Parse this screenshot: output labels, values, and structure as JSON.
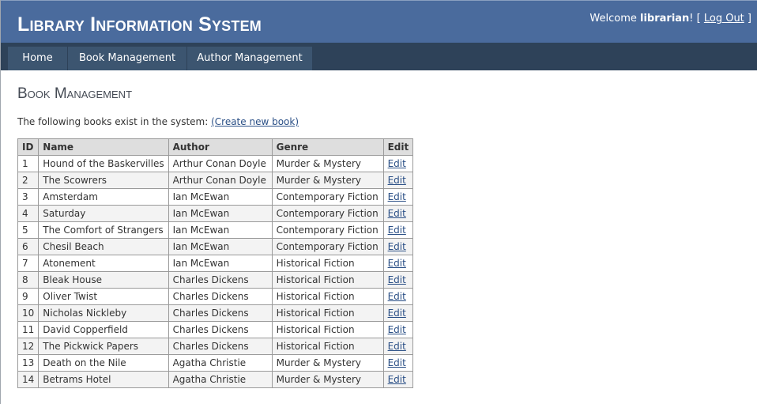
{
  "header": {
    "title": "Library Information System",
    "welcome_prefix": "Welcome ",
    "username": "librarian",
    "welcome_suffix": "! [ ",
    "logout_label": "Log Out",
    "bracket_close": " ]"
  },
  "nav": {
    "items": [
      {
        "label": "Home"
      },
      {
        "label": "Book Management"
      },
      {
        "label": "Author Management"
      }
    ]
  },
  "main": {
    "title": "Book Management",
    "intro_text": "The following books exist in the system: ",
    "create_link": "(Create new book)"
  },
  "table": {
    "columns": [
      "ID",
      "Name",
      "Author",
      "Genre",
      "Edit"
    ],
    "rows": [
      {
        "id": "1",
        "name": "Hound of the Baskervilles",
        "author": "Arthur Conan Doyle",
        "genre": "Murder & Mystery",
        "edit": "Edit"
      },
      {
        "id": "2",
        "name": "The Scowrers",
        "author": "Arthur Conan Doyle",
        "genre": "Murder & Mystery",
        "edit": "Edit"
      },
      {
        "id": "3",
        "name": "Amsterdam",
        "author": "Ian McEwan",
        "genre": "Contemporary Fiction",
        "edit": "Edit"
      },
      {
        "id": "4",
        "name": "Saturday",
        "author": "Ian McEwan",
        "genre": "Contemporary Fiction",
        "edit": "Edit"
      },
      {
        "id": "5",
        "name": "The Comfort of Strangers",
        "author": "Ian McEwan",
        "genre": "Contemporary Fiction",
        "edit": "Edit"
      },
      {
        "id": "6",
        "name": "Chesil Beach",
        "author": "Ian McEwan",
        "genre": "Contemporary Fiction",
        "edit": "Edit"
      },
      {
        "id": "7",
        "name": "Atonement",
        "author": "Ian McEwan",
        "genre": "Historical Fiction",
        "edit": "Edit"
      },
      {
        "id": "8",
        "name": "Bleak House",
        "author": "Charles Dickens",
        "genre": "Historical Fiction",
        "edit": "Edit"
      },
      {
        "id": "9",
        "name": "Oliver Twist",
        "author": "Charles Dickens",
        "genre": "Historical Fiction",
        "edit": "Edit"
      },
      {
        "id": "10",
        "name": "Nicholas Nickleby",
        "author": "Charles Dickens",
        "genre": "Historical Fiction",
        "edit": "Edit"
      },
      {
        "id": "11",
        "name": "David Copperfield",
        "author": "Charles Dickens",
        "genre": "Historical Fiction",
        "edit": "Edit"
      },
      {
        "id": "12",
        "name": "The Pickwick Papers",
        "author": "Charles Dickens",
        "genre": "Historical Fiction",
        "edit": "Edit"
      },
      {
        "id": "13",
        "name": "Death on the Nile",
        "author": "Agatha Christie",
        "genre": "Murder & Mystery",
        "edit": "Edit"
      },
      {
        "id": "14",
        "name": "Betrams Hotel",
        "author": "Agatha Christie",
        "genre": "Murder & Mystery",
        "edit": "Edit"
      }
    ]
  },
  "colors": {
    "header_bg": "#4a6b9d",
    "nav_bg": "#2e4259",
    "nav_item_bg": "#3c5570",
    "link": "#2a4f86"
  }
}
